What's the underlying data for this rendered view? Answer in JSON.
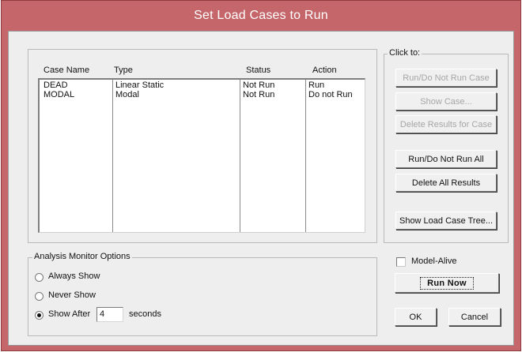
{
  "window": {
    "title": "Set Load Cases to Run"
  },
  "cases_table": {
    "columns": [
      "Case Name",
      "Type",
      "Status",
      "Action"
    ],
    "rows": [
      [
        "DEAD",
        "Linear Static",
        "Not Run",
        "Run"
      ],
      [
        "MODAL",
        "Modal",
        "Not Run",
        "Do not Run"
      ]
    ]
  },
  "click_to": {
    "label": "Click to:",
    "run_do_not_run_case": "Run/Do Not Run Case",
    "show_case": "Show Case...",
    "delete_results_for_case": "Delete Results for Case",
    "run_do_not_run_all": "Run/Do Not Run All",
    "delete_all_results": "Delete All Results",
    "show_load_case_tree": "Show Load Case Tree..."
  },
  "analysis_monitor": {
    "label": "Analysis Monitor Options",
    "always_show": "Always Show",
    "never_show": "Never Show",
    "show_after": "Show After",
    "show_after_value": "4",
    "seconds": "seconds",
    "selected": "show_after"
  },
  "model_alive": {
    "label": "Model-Alive",
    "checked": false
  },
  "buttons": {
    "run_now": "Run Now",
    "ok": "OK",
    "cancel": "Cancel"
  },
  "colors": {
    "title_bar": "#c4666a",
    "dialog_bg": "#eeeeee"
  }
}
